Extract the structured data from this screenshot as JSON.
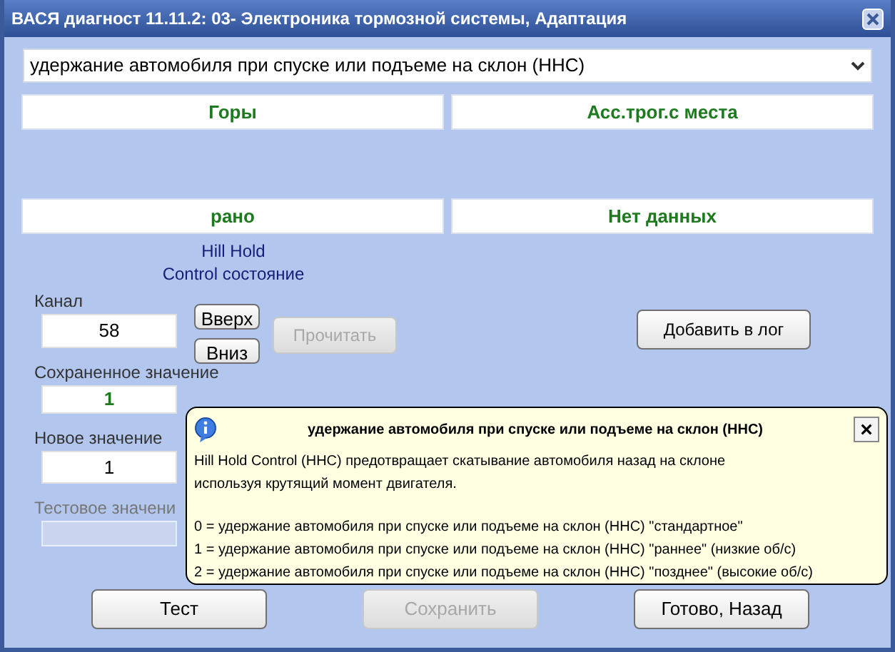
{
  "window": {
    "title": "ВАСЯ диагност 11.11.2: 03- Электроника тормозной системы, Адаптация"
  },
  "dropdown": {
    "value": "удержание автомобиля при спуске или подъеме на склон (HHC)"
  },
  "value_boxes": [
    {
      "text": "Горы"
    },
    {
      "text": "Асс.трог.с места"
    },
    {
      "text": "рано"
    },
    {
      "text": "Нет данных"
    }
  ],
  "status_label": [
    "Hill Hold",
    "Control состояние"
  ],
  "channel": {
    "label": "Канал",
    "value": "58"
  },
  "saved_value": {
    "label": "Сохраненное значение",
    "value": "1"
  },
  "new_value": {
    "label": "Новое значение",
    "value": "1"
  },
  "test_value": {
    "label": "Тестовое значени",
    "disabled": true
  },
  "channel_buttons": [
    {
      "label": "Вверх",
      "disabled": false
    },
    {
      "label": "Вниз",
      "disabled": false
    }
  ],
  "read_button": {
    "label": "Прочитать",
    "disabled": true
  },
  "log_button": {
    "label": "Добавить в лог",
    "disabled": false
  },
  "bottom_buttons": [
    {
      "label": "Тест",
      "disabled": false
    },
    {
      "label": "Сохранить",
      "disabled": true
    },
    {
      "label": "Готово, Назад",
      "disabled": false
    }
  ],
  "tooltip": {
    "title": "удержание автомобиля при спуске или подъеме на склон (HHC)",
    "close": "×",
    "paragraphs": [
      "Hill Hold Control (HHC) предотвращает скатывание автомобиля назад на склоне используя крутящий момент двигателя."
    ],
    "options": [
      "0 = удержание автомобиля при спуске или подъеме на склон (HHC) \"стандартное\"",
      "1 = удержание автомобиля при спуске или подъеме на склон (HHC) \"раннее\" (низкие об/с)",
      "2 = удержание автомобиля при спуске или подъеме на склон (HHC) \"позднее\" (высокие об/с)"
    ]
  }
}
